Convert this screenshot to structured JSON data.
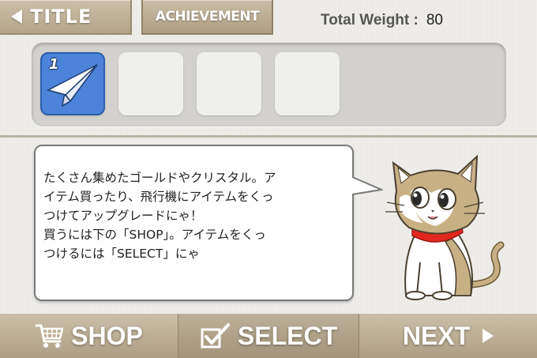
{
  "header": {
    "title_button": "TITLE",
    "achievement_button": "ACHIEVEMENT",
    "weight_label": "Total Weight :",
    "weight_value": "80"
  },
  "slots": [
    {
      "number": "1",
      "item": "paper-plane-icon",
      "filled": true
    },
    {
      "filled": false
    },
    {
      "filled": false
    },
    {
      "filled": false
    }
  ],
  "dialog": {
    "lines": [
      "たくさん集めたゴールドやクリスタル。ア",
      "イテム買ったり、飛行機にアイテムをくっ",
      "つけてアップグレードにゃ！",
      "買うには下の「SHOP」。アイテムをくっ",
      "つけるには「SELECT」にゃ"
    ]
  },
  "footer": {
    "shop_label": "SHOP",
    "select_label": "SELECT",
    "next_label": "NEXT"
  },
  "colors": {
    "button_tan": "#b8aa8f",
    "slot_selected": "#4d83d8",
    "collar_red": "#e0281e"
  }
}
